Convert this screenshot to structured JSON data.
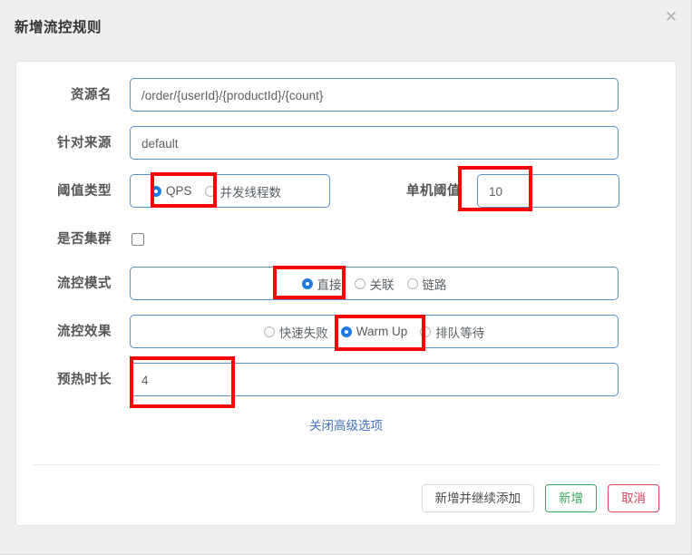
{
  "dialog": {
    "title": "新增流控规则",
    "close_icon": "close-icon"
  },
  "form": {
    "resource": {
      "label": "资源名",
      "value": "/order/{userId}/{productId}/{count}"
    },
    "limit_app": {
      "label": "针对来源",
      "value": "default"
    },
    "grade": {
      "label": "阈值类型",
      "options": [
        {
          "label": "QPS",
          "selected": true
        },
        {
          "label": "并发线程数",
          "selected": false
        }
      ]
    },
    "threshold": {
      "label": "单机阈值",
      "value": "10"
    },
    "cluster": {
      "label": "是否集群",
      "checked": false
    },
    "strategy": {
      "label": "流控模式",
      "options": [
        {
          "label": "直接",
          "selected": true
        },
        {
          "label": "关联",
          "selected": false
        },
        {
          "label": "链路",
          "selected": false
        }
      ]
    },
    "control_behavior": {
      "label": "流控效果",
      "options": [
        {
          "label": "快速失败",
          "selected": false
        },
        {
          "label": "Warm Up",
          "selected": true
        },
        {
          "label": "排队等待",
          "selected": false
        }
      ]
    },
    "warm_up_period": {
      "label": "预热时长",
      "value": "4"
    },
    "advanced_link": "关闭高级选项"
  },
  "footer": {
    "add_continue_label": "新增并继续添加",
    "add_label": "新增",
    "cancel_label": "取消"
  },
  "colors": {
    "accent_blue": "#1f7ae0",
    "field_border": "#5a8fc4",
    "link_blue": "#4272b8",
    "success_green": "#39a85b",
    "danger_red": "#d9435f",
    "annotation_red": "#ff0000"
  }
}
